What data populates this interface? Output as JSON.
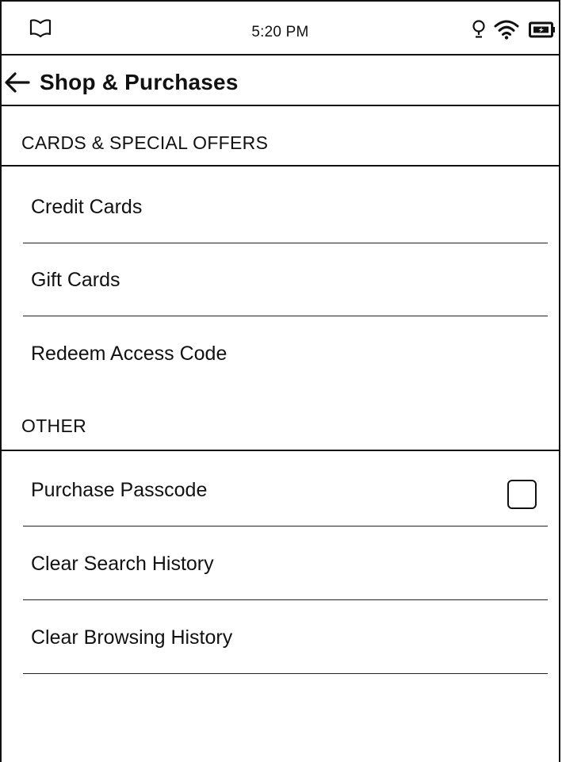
{
  "status_bar": {
    "time": "5:20 PM",
    "icons": [
      "book-icon",
      "lightbulb-icon",
      "wifi-icon",
      "battery-charging-icon"
    ]
  },
  "header": {
    "title": "Shop & Purchases",
    "back_icon": "back-arrow-icon"
  },
  "sections": [
    {
      "title": "CARDS & SPECIAL OFFERS",
      "items": [
        {
          "label": "Credit Cards"
        },
        {
          "label": "Gift Cards"
        },
        {
          "label": "Redeem Access Code"
        }
      ]
    },
    {
      "title": "OTHER",
      "items": [
        {
          "label": "Purchase Passcode",
          "control": "checkbox",
          "checked": false
        },
        {
          "label": "Clear Search History"
        },
        {
          "label": "Clear Browsing History"
        }
      ]
    }
  ]
}
